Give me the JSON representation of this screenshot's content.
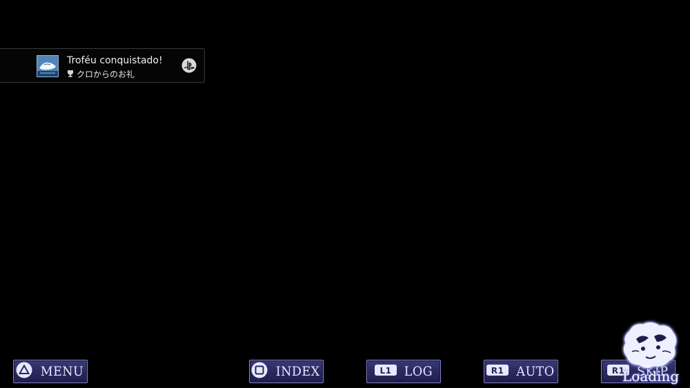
{
  "notification": {
    "title": "Troféu conquistado!",
    "trophy_name": "クロからのお礼",
    "icons": [
      "trophy-image",
      "trophy-cup-icon",
      "playstation-logo-icon"
    ]
  },
  "hud": {
    "menu": {
      "icon": "triangle-button-icon",
      "label": "MENU"
    },
    "index": {
      "icon": "square-button-icon",
      "label": "INDEX"
    },
    "log": {
      "icon": "l1-button-icon",
      "icon_text": "L1",
      "label": "LOG"
    },
    "auto": {
      "icon": "r1-button-icon",
      "icon_text": "R1",
      "label": "AUTO"
    },
    "skip": {
      "icon": "r1-button-icon",
      "icon_text": "R1",
      "label": "SKIP"
    }
  },
  "loading": {
    "label": "Loading",
    "icon": "cat-emblem-icon"
  },
  "colors": {
    "background": "#000000",
    "button_border": "#8c89c9",
    "button_fill": "#2a2a60",
    "button_text": "#e6e6ff",
    "glow": "#6f73d8"
  }
}
